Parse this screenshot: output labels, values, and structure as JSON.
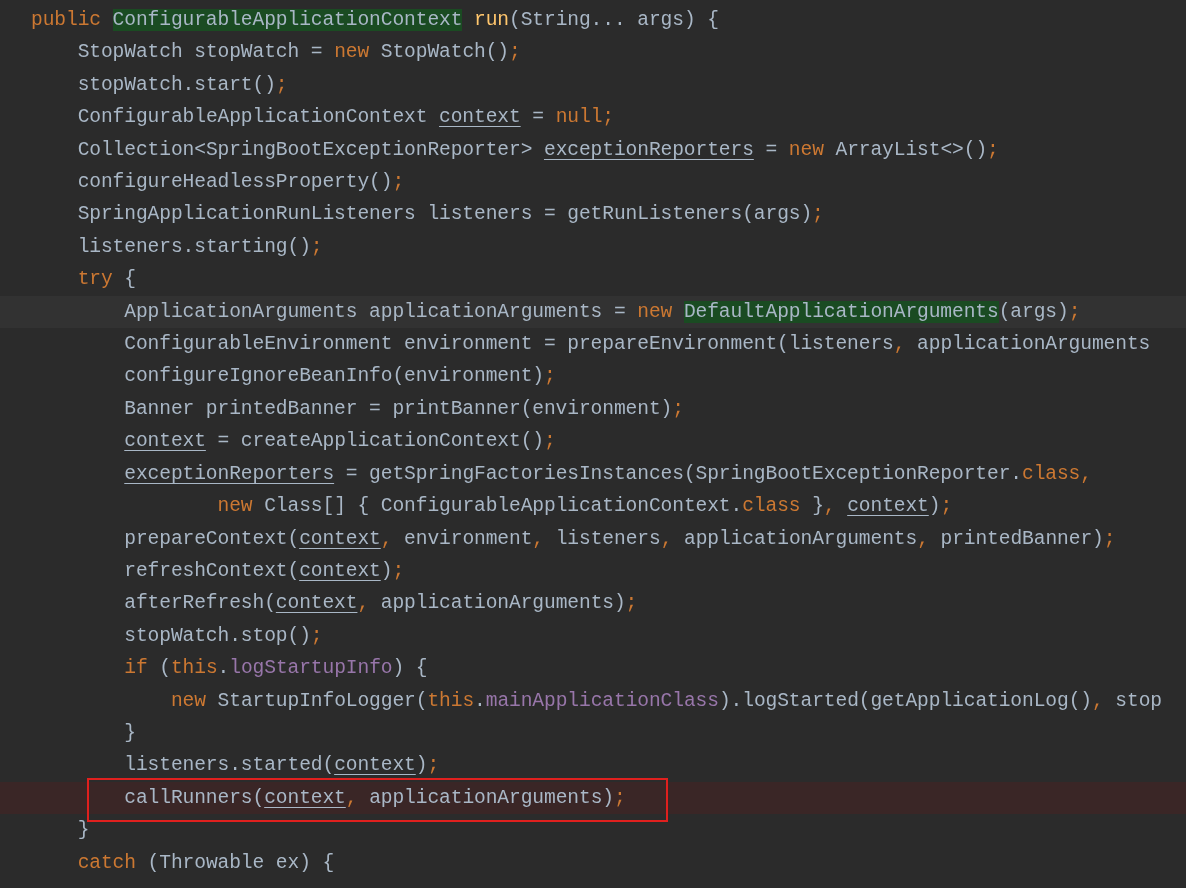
{
  "editor": {
    "lines": [
      {
        "current": false,
        "breakpoint": false,
        "boxed": false,
        "tokens": [
          {
            "text": "public ",
            "kind": "k"
          },
          {
            "text": "ConfigurableApplicationContext",
            "kind": "h"
          },
          {
            "text": " run",
            "kind": "m"
          },
          {
            "text": "(String... args) {",
            "kind": "p"
          }
        ]
      },
      {
        "current": false,
        "breakpoint": false,
        "boxed": false,
        "tokens": [
          {
            "text": "    StopWatch stopWatch = ",
            "kind": "p"
          },
          {
            "text": "new",
            "kind": "k"
          },
          {
            "text": " StopWatch()",
            "kind": "p"
          },
          {
            "text": ";",
            "kind": "k"
          }
        ]
      },
      {
        "current": false,
        "breakpoint": false,
        "boxed": false,
        "tokens": [
          {
            "text": "    stopWatch.start()",
            "kind": "p"
          },
          {
            "text": ";",
            "kind": "k"
          }
        ]
      },
      {
        "current": false,
        "breakpoint": false,
        "boxed": false,
        "tokens": [
          {
            "text": "    ConfigurableApplicationContext ",
            "kind": "p"
          },
          {
            "text": "context",
            "kind": "v"
          },
          {
            "text": " = ",
            "kind": "p"
          },
          {
            "text": "null;",
            "kind": "k"
          }
        ]
      },
      {
        "current": false,
        "breakpoint": false,
        "boxed": false,
        "tokens": [
          {
            "text": "    Collection<SpringBootExceptionReporter> ",
            "kind": "p"
          },
          {
            "text": "exceptionReporters",
            "kind": "v"
          },
          {
            "text": " = ",
            "kind": "p"
          },
          {
            "text": "new",
            "kind": "k"
          },
          {
            "text": " ArrayList<>()",
            "kind": "p"
          },
          {
            "text": ";",
            "kind": "k"
          }
        ]
      },
      {
        "current": false,
        "breakpoint": false,
        "boxed": false,
        "tokens": [
          {
            "text": "    configureHeadlessProperty()",
            "kind": "p"
          },
          {
            "text": ";",
            "kind": "k"
          }
        ]
      },
      {
        "current": false,
        "breakpoint": false,
        "boxed": false,
        "tokens": [
          {
            "text": "    SpringApplicationRunListeners listeners = getRunListeners(args)",
            "kind": "p"
          },
          {
            "text": ";",
            "kind": "k"
          }
        ]
      },
      {
        "current": false,
        "breakpoint": false,
        "boxed": false,
        "tokens": [
          {
            "text": "    listeners.starting()",
            "kind": "p"
          },
          {
            "text": ";",
            "kind": "k"
          }
        ]
      },
      {
        "current": false,
        "breakpoint": false,
        "boxed": false,
        "tokens": [
          {
            "text": "    try",
            "kind": "k"
          },
          {
            "text": " {",
            "kind": "p"
          }
        ]
      },
      {
        "current": true,
        "breakpoint": false,
        "boxed": false,
        "tokens": [
          {
            "text": "        ApplicationArguments applicationArguments = ",
            "kind": "p"
          },
          {
            "text": "new",
            "kind": "k"
          },
          {
            "text": " DefaultApplicationArguments",
            "kind": "h"
          },
          {
            "text": "(args)",
            "kind": "p"
          },
          {
            "text": ";",
            "kind": "k"
          }
        ]
      },
      {
        "current": false,
        "breakpoint": false,
        "boxed": false,
        "tokens": [
          {
            "text": "        ConfigurableEnvironment environment = prepareEnvironment(listeners",
            "kind": "p"
          },
          {
            "text": ",",
            "kind": "k"
          },
          {
            "text": " applicationArguments",
            "kind": "p"
          }
        ]
      },
      {
        "current": false,
        "breakpoint": false,
        "boxed": false,
        "tokens": [
          {
            "text": "        configureIgnoreBeanInfo(environment)",
            "kind": "p"
          },
          {
            "text": ";",
            "kind": "k"
          }
        ]
      },
      {
        "current": false,
        "breakpoint": false,
        "boxed": false,
        "tokens": [
          {
            "text": "        Banner printedBanner = printBanner(environment)",
            "kind": "p"
          },
          {
            "text": ";",
            "kind": "k"
          }
        ]
      },
      {
        "current": false,
        "breakpoint": false,
        "boxed": false,
        "tokens": [
          {
            "text": "        context",
            "kind": "v"
          },
          {
            "text": " = createApplicationContext()",
            "kind": "p"
          },
          {
            "text": ";",
            "kind": "k"
          }
        ]
      },
      {
        "current": false,
        "breakpoint": false,
        "boxed": false,
        "tokens": [
          {
            "text": "        exceptionReporters",
            "kind": "v"
          },
          {
            "text": " = getSpringFactoriesInstances(SpringBootExceptionReporter.",
            "kind": "p"
          },
          {
            "text": "class,",
            "kind": "k"
          }
        ]
      },
      {
        "current": false,
        "breakpoint": false,
        "boxed": false,
        "tokens": [
          {
            "text": "                new",
            "kind": "k"
          },
          {
            "text": " Class[] { ConfigurableApplicationContext.",
            "kind": "p"
          },
          {
            "text": "class",
            "kind": "k"
          },
          {
            "text": " }",
            "kind": "p"
          },
          {
            "text": ",",
            "kind": "k"
          },
          {
            "text": " context",
            "kind": "v"
          },
          {
            "text": ")",
            "kind": "p"
          },
          {
            "text": ";",
            "kind": "k"
          }
        ]
      },
      {
        "current": false,
        "breakpoint": false,
        "boxed": false,
        "tokens": [
          {
            "text": "        prepareContext(",
            "kind": "p"
          },
          {
            "text": "context",
            "kind": "v"
          },
          {
            "text": ",",
            "kind": "k"
          },
          {
            "text": " environment",
            "kind": "p"
          },
          {
            "text": ",",
            "kind": "k"
          },
          {
            "text": " listeners",
            "kind": "p"
          },
          {
            "text": ",",
            "kind": "k"
          },
          {
            "text": " applicationArguments",
            "kind": "p"
          },
          {
            "text": ",",
            "kind": "k"
          },
          {
            "text": " printedBanner)",
            "kind": "p"
          },
          {
            "text": ";",
            "kind": "k"
          }
        ]
      },
      {
        "current": false,
        "breakpoint": false,
        "boxed": false,
        "tokens": [
          {
            "text": "        refreshContext(",
            "kind": "p"
          },
          {
            "text": "context",
            "kind": "v"
          },
          {
            "text": ")",
            "kind": "p"
          },
          {
            "text": ";",
            "kind": "k"
          }
        ]
      },
      {
        "current": false,
        "breakpoint": false,
        "boxed": false,
        "tokens": [
          {
            "text": "        afterRefresh(",
            "kind": "p"
          },
          {
            "text": "context",
            "kind": "v"
          },
          {
            "text": ",",
            "kind": "k"
          },
          {
            "text": " applicationArguments)",
            "kind": "p"
          },
          {
            "text": ";",
            "kind": "k"
          }
        ]
      },
      {
        "current": false,
        "breakpoint": false,
        "boxed": false,
        "tokens": [
          {
            "text": "        stopWatch.stop()",
            "kind": "p"
          },
          {
            "text": ";",
            "kind": "k"
          }
        ]
      },
      {
        "current": false,
        "breakpoint": false,
        "boxed": false,
        "tokens": [
          {
            "text": "        if",
            "kind": "k"
          },
          {
            "text": " (",
            "kind": "p"
          },
          {
            "text": "this",
            "kind": "k"
          },
          {
            "text": ".",
            "kind": "p"
          },
          {
            "text": "logStartupInfo",
            "kind": "f"
          },
          {
            "text": ") {",
            "kind": "p"
          }
        ]
      },
      {
        "current": false,
        "breakpoint": false,
        "boxed": false,
        "tokens": [
          {
            "text": "            new",
            "kind": "k"
          },
          {
            "text": " StartupInfoLogger(",
            "kind": "p"
          },
          {
            "text": "this",
            "kind": "k"
          },
          {
            "text": ".",
            "kind": "p"
          },
          {
            "text": "mainApplicationClass",
            "kind": "f"
          },
          {
            "text": ").logStarted(getApplicationLog()",
            "kind": "p"
          },
          {
            "text": ",",
            "kind": "k"
          },
          {
            "text": " stop",
            "kind": "p"
          }
        ]
      },
      {
        "current": false,
        "breakpoint": false,
        "boxed": false,
        "tokens": [
          {
            "text": "        }",
            "kind": "p"
          }
        ]
      },
      {
        "current": false,
        "breakpoint": false,
        "boxed": false,
        "tokens": [
          {
            "text": "        listeners.started(",
            "kind": "p"
          },
          {
            "text": "context",
            "kind": "v"
          },
          {
            "text": ")",
            "kind": "p"
          },
          {
            "text": ";",
            "kind": "k"
          }
        ]
      },
      {
        "current": false,
        "breakpoint": true,
        "boxed": true,
        "tokens": [
          {
            "text": "        callRunners(",
            "kind": "p"
          },
          {
            "text": "context",
            "kind": "v"
          },
          {
            "text": ",",
            "kind": "k"
          },
          {
            "text": " applicationArguments)",
            "kind": "p"
          },
          {
            "text": ";",
            "kind": "k"
          }
        ]
      },
      {
        "current": false,
        "breakpoint": false,
        "boxed": false,
        "tokens": [
          {
            "text": "    }",
            "kind": "p"
          }
        ]
      },
      {
        "current": false,
        "breakpoint": false,
        "boxed": false,
        "tokens": [
          {
            "text": "    catch",
            "kind": "k"
          },
          {
            "text": " (Throwable ex) {",
            "kind": "p"
          }
        ]
      }
    ]
  }
}
